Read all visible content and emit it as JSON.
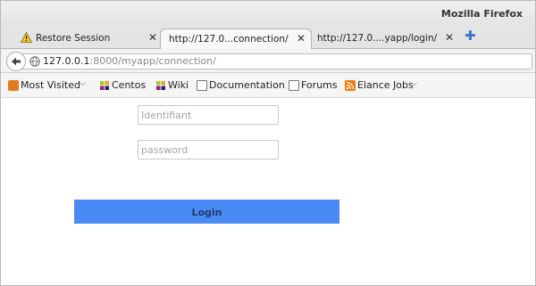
{
  "window": {
    "title": "Mozilla Firefox"
  },
  "tabs": [
    {
      "label": "Restore Session",
      "icon": "warning-icon",
      "active": false
    },
    {
      "label": "http://127.0...connection/",
      "active": true
    },
    {
      "label": "http://127.0....yapp/login/",
      "active": false
    }
  ],
  "tab_close_glyph": "✕",
  "new_tab_glyph": "✚",
  "urlbar": {
    "host": "127.0.0.1",
    "rest": ":8000/myapp/connection/"
  },
  "bookmarks": [
    {
      "label": "Most Visited",
      "icon": "folder-icon",
      "dropdown": true
    },
    {
      "label": "Centos",
      "icon": "centos-icon"
    },
    {
      "label": "Wiki",
      "icon": "centos-icon"
    },
    {
      "label": "Documentation",
      "icon": "page-icon"
    },
    {
      "label": "Forums",
      "icon": "page-icon"
    },
    {
      "label": "Elance Jobs",
      "icon": "rss-icon",
      "dropdown": true
    }
  ],
  "form": {
    "username_placeholder": "Identifiant",
    "password_placeholder": "password",
    "login_label": "Login"
  },
  "colors": {
    "login_button": "#4a8af4",
    "login_text": "#1f3d70",
    "new_tab_plus": "#3a74c9"
  }
}
